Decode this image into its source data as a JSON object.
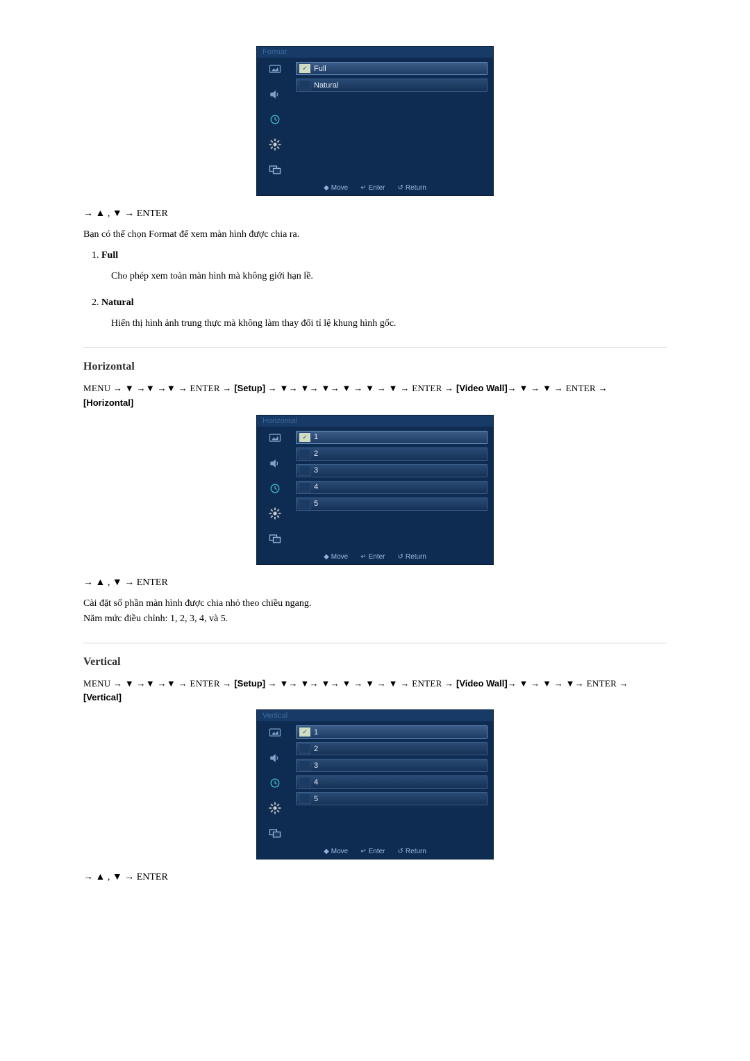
{
  "section_format": {
    "osd_title": "Format",
    "options": [
      {
        "label": "Full",
        "checked": true
      },
      {
        "label": "Natural",
        "checked": false
      }
    ],
    "footer": {
      "move": "Move",
      "enter": "Enter",
      "return": "Return"
    },
    "nav_line": "→ ▲ , ▼ → ENTER",
    "description": "Bạn có thể chọn Format để xem màn hình được chia ra.",
    "list": [
      {
        "title": "Full",
        "body": "Cho phép xem toàn màn hình mà không giới hạn lề."
      },
      {
        "title": "Natural",
        "body": "Hiển thị hình ảnh trung thực mà không làm thay đổi tỉ lệ khung hình gốc."
      }
    ]
  },
  "section_horizontal": {
    "heading": "Horizontal",
    "path_prefix": "MENU → ▼ →▼ →▼ → ENTER → ",
    "path_setup": "[Setup]",
    "path_mid": " → ▼→ ▼→ ▼→ ▼ → ▼ → ▼ → ENTER → ",
    "path_videowall": "[Video Wall]",
    "path_suffix": "→ ▼ → ▼ → ENTER → ",
    "path_final": "[Horizontal]",
    "osd_title": "Horizontal",
    "options": [
      {
        "label": "1",
        "checked": true
      },
      {
        "label": "2",
        "checked": false
      },
      {
        "label": "3",
        "checked": false
      },
      {
        "label": "4",
        "checked": false
      },
      {
        "label": "5",
        "checked": false
      }
    ],
    "footer": {
      "move": "Move",
      "enter": "Enter",
      "return": "Return"
    },
    "nav_line": "→ ▲ , ▼ → ENTER",
    "desc1": "Cài đặt số phần màn hình được chia nhỏ theo chiều ngang.",
    "desc2": "Năm mức điều chỉnh: 1, 2, 3, 4, và 5."
  },
  "section_vertical": {
    "heading": "Vertical",
    "path_prefix": "MENU → ▼ →▼ →▼ → ENTER → ",
    "path_setup": "[Setup]",
    "path_mid": " → ▼→ ▼→ ▼→ ▼ → ▼ → ▼ → ENTER → ",
    "path_videowall": "[Video Wall]",
    "path_suffix": "→ ▼ → ▼ → ▼→ ENTER → ",
    "path_final": "[Vertical]",
    "osd_title": "Vertical",
    "options": [
      {
        "label": "1",
        "checked": true
      },
      {
        "label": "2",
        "checked": false
      },
      {
        "label": "3",
        "checked": false
      },
      {
        "label": "4",
        "checked": false
      },
      {
        "label": "5",
        "checked": false
      }
    ],
    "footer": {
      "move": "Move",
      "enter": "Enter",
      "return": "Return"
    },
    "nav_line": "→ ▲ , ▼ → ENTER"
  },
  "icons_hint": {
    "picture": "picture-icon",
    "sound": "sound-icon",
    "clock": "clock-icon",
    "gear": "gear-icon",
    "multi": "multi-icon"
  }
}
